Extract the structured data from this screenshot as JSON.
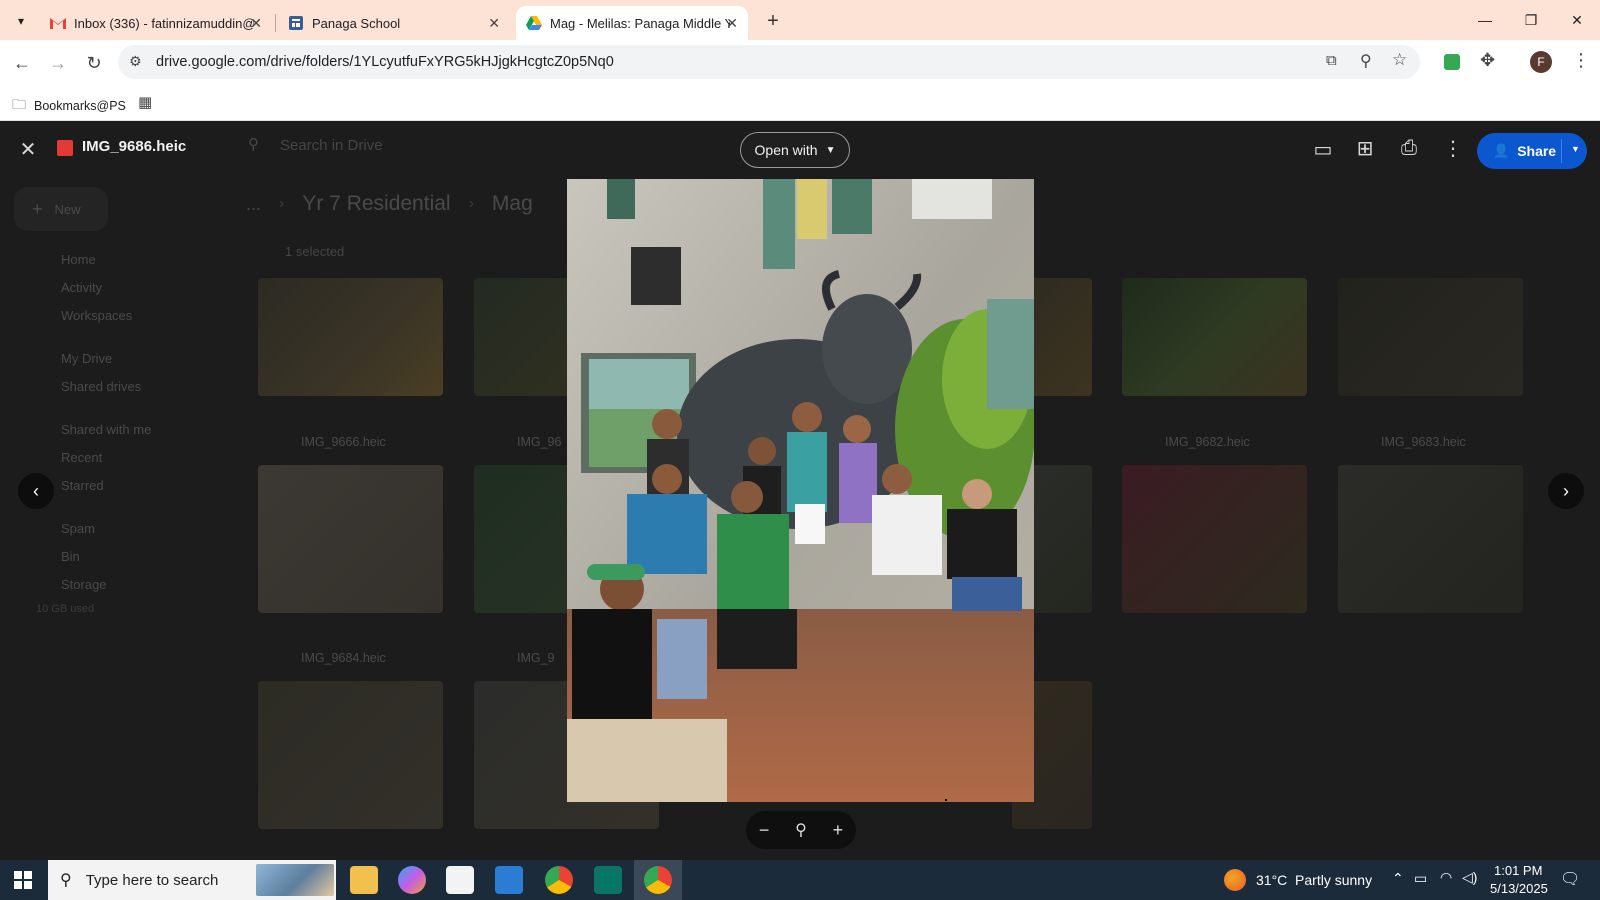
{
  "browser": {
    "tabs": [
      {
        "label": "Inbox (336) - fatinnizamuddin@",
        "icon": "gmail-icon",
        "active": false
      },
      {
        "label": "Panaga School",
        "icon": "forms-icon",
        "active": false
      },
      {
        "label": "Mag - Melilas: Panaga Middle Y",
        "icon": "drive-icon",
        "active": true
      }
    ],
    "new_tab": "+",
    "url": "drive.google.com/drive/folders/1YLcyutfuFxYRG5kHJjgkHcgtcZ0p5Nq0",
    "bookmarks_label": "Bookmarks@PS",
    "profile_initial": "F"
  },
  "drive": {
    "search_placeholder": "Search in Drive",
    "new_label": "New",
    "breadcrumb": {
      "ellipsis": "...",
      "parent": "Yr 7 Residential",
      "current": "Mag"
    },
    "selection_text": "1 selected",
    "sidebar": [
      "Home",
      "Activity",
      "Workspaces",
      "My Drive",
      "Shared drives",
      "Shared with me",
      "Recent",
      "Starred",
      "Spam",
      "Bin",
      "Storage"
    ],
    "storage_text": "10 GB used",
    "files": [
      "IMG_9666.heic",
      "IMG_96",
      "IMG_9682.heic",
      "IMG_9683.heic",
      "IMG_9684.heic",
      "IMG_9"
    ]
  },
  "viewer": {
    "file_name": "IMG_9686.heic",
    "open_with_label": "Open with",
    "share_label": "Share",
    "zoom_out": "−",
    "zoom_in": "+"
  },
  "taskbar": {
    "search_placeholder": "Type here to search",
    "weather": "31°C  Partly sunny",
    "time": "1:01 PM",
    "date": "5/13/2025"
  },
  "colors": {
    "tabbar_bg": "#fde3d6",
    "share_blue": "#0b57d0",
    "viewer_bg": "#1f1f1f",
    "taskbar_bg": "#1c2b3a"
  }
}
